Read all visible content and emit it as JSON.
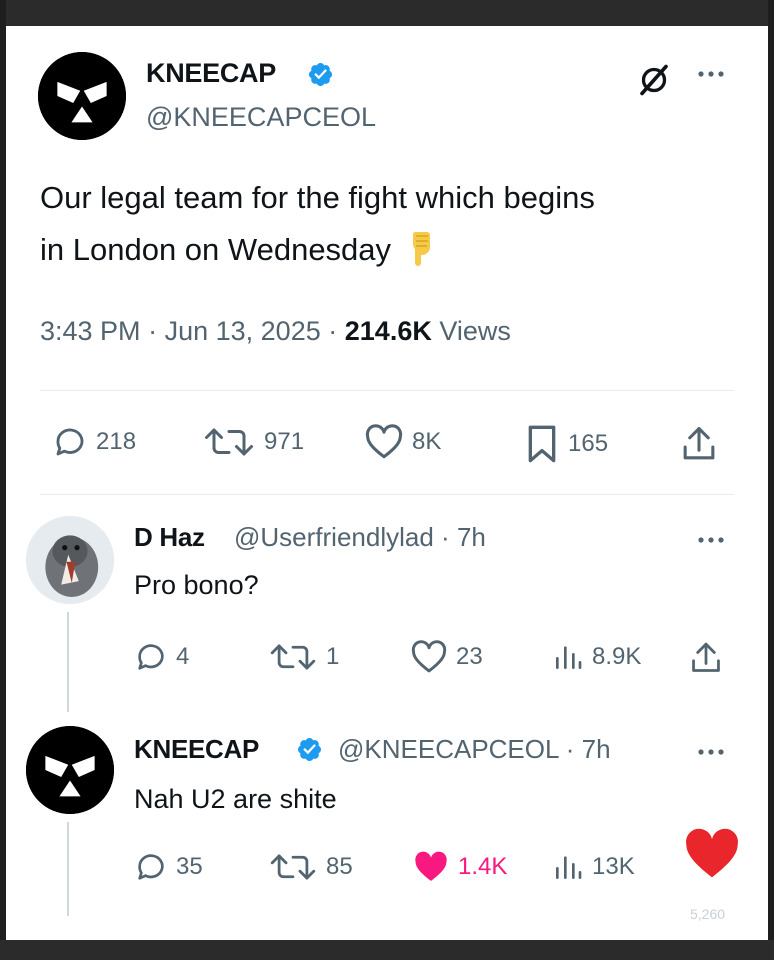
{
  "main_tweet": {
    "author_name": "KNEECAP",
    "author_handle": "@KNEECAPCEOL",
    "text_line1": "Our legal team for the fight which begins",
    "text_line2": "in London on Wednesday",
    "emoji": "point-down-emoji",
    "time": "3:43 PM",
    "date": "Jun 13, 2025",
    "views_count": "214.6K",
    "views_label": "Views",
    "separator": "·",
    "replies": "218",
    "reposts": "971",
    "likes": "8K",
    "bookmarks": "165"
  },
  "reply1": {
    "author_name": "D Haz",
    "author_handle": "@Userfriendlylad",
    "time": "7h",
    "text": "Pro bono?",
    "replies": "4",
    "reposts": "1",
    "likes": "23",
    "views": "8.9K"
  },
  "reply2": {
    "author_name": "KNEECAP",
    "author_handle": "@KNEECAPCEOL",
    "time": "7h",
    "text": "Nah U2 are shite",
    "replies": "35",
    "reposts": "85",
    "likes": "1.4K",
    "views": "13K"
  },
  "overlay": {
    "reaction": "red-heart",
    "watermark": "5,260"
  },
  "colors": {
    "verified": "#1d9bf0",
    "text_secondary": "#536471",
    "liked": "#f91880",
    "heart_reaction": "#e8262b"
  }
}
